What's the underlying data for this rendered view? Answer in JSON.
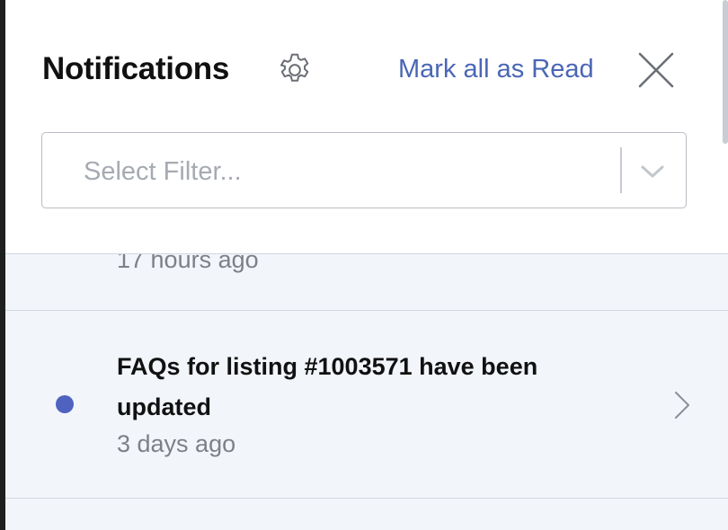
{
  "header": {
    "title": "Notifications",
    "mark_all_read_label": "Mark all as Read"
  },
  "filter": {
    "placeholder": "Select Filter...",
    "value": ""
  },
  "notifications": [
    {
      "message": "",
      "time": "17 hours ago",
      "unread": false
    },
    {
      "message": "FAQs for listing #1003571 have been updated",
      "time": "3 days ago",
      "unread": true
    }
  ],
  "icons": {
    "settings": "gear-icon",
    "close": "close-icon",
    "dropdown": "chevron-down-icon",
    "open": "chevron-right-icon"
  },
  "colors": {
    "accent": "#4a66b5",
    "unread_dot": "#5062c0",
    "list_bg": "#f2f5fa"
  }
}
